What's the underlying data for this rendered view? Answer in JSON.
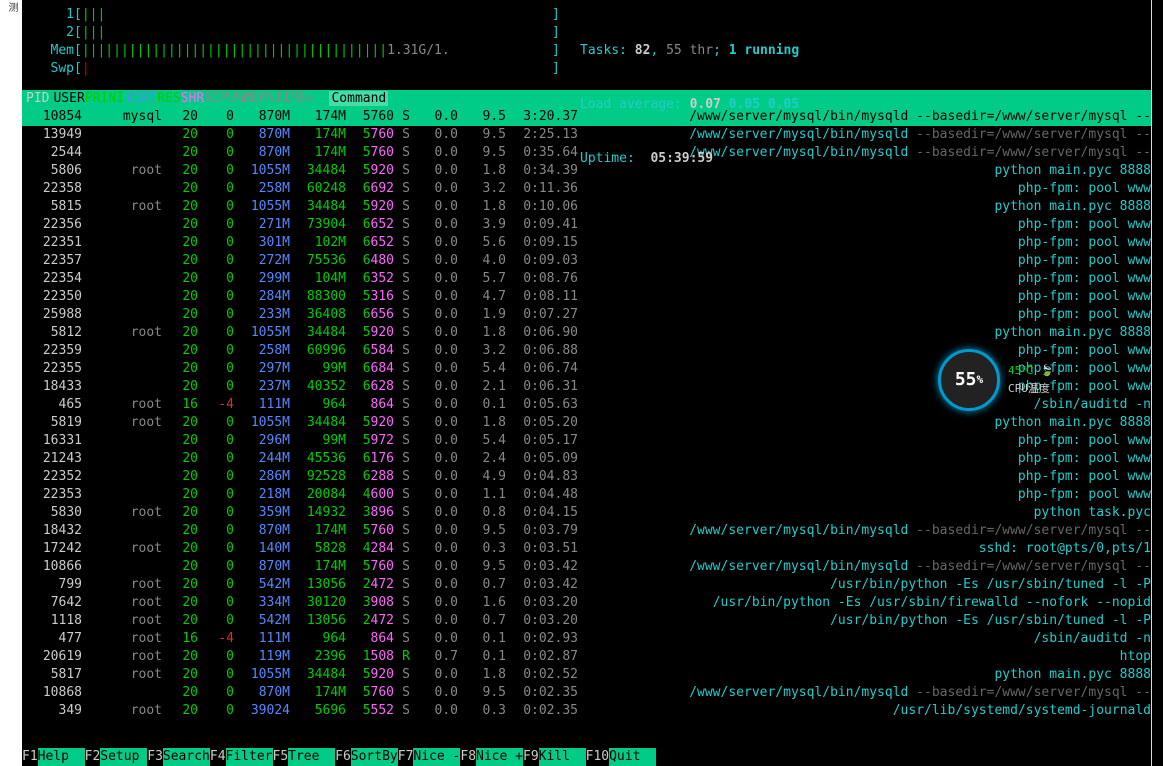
{
  "cpu_meters": [
    {
      "label": "1",
      "bars": "|||",
      "close": "]"
    },
    {
      "label": "2",
      "bars": "|||",
      "close": "]"
    }
  ],
  "mem": {
    "label": "Mem",
    "bars": "|||||||||||||||||||||||||||||||||||||||",
    "text": "1.31G/1.",
    "close": "]"
  },
  "swp": {
    "label": "Swp",
    "bars": "|",
    "close": "]"
  },
  "tasks": {
    "label": "Tasks:",
    "count": "82",
    "sep": ",",
    "thr": "55 thr",
    "running": "1 running"
  },
  "load": {
    "label": "Load average:",
    "v1": "0.07",
    "v2": "0.05",
    "v3": "0.05"
  },
  "uptime": {
    "label": "Uptime:",
    "value": "05:39:59"
  },
  "columns": {
    "pid": "PID",
    "user": "USER",
    "pri": "PRI",
    "ni": "NI",
    "virt": "VIRT",
    "res": "RES",
    "shr": "SHR",
    "s": "S",
    "cpu": "CPU%",
    "mem": "MEM%",
    "time": "TIME+",
    "cmd": "Command"
  },
  "processes": [
    {
      "pid": "10854",
      "user": "mysql",
      "pri": "20",
      "ni": "0",
      "virt": "870M",
      "res": "174M",
      "shr": "5760",
      "s": "S",
      "cpu": "0.0",
      "mem": "9.5",
      "time": "3:20.37",
      "cmd": "/www/server/mysql/bin/mysqld",
      "args": " --basedir=/www/server/mysql --",
      "selected": true
    },
    {
      "pid": "13949",
      "user": "",
      "pri": "20",
      "ni": "0",
      "virt": "870M",
      "res": "174M",
      "shr": "5760",
      "s": "S",
      "cpu": "0.0",
      "mem": "9.5",
      "time": "2:25.13",
      "cmd": "/www/server/mysql/bin/mysqld",
      "args": " --basedir=/www/server/mysql --"
    },
    {
      "pid": "2544",
      "user": "",
      "pri": "20",
      "ni": "0",
      "virt": "870M",
      "res": "174M",
      "shr": "5760",
      "s": "S",
      "cpu": "0.0",
      "mem": "9.5",
      "time": "0:35.64",
      "cmd": "/www/server/mysql/bin/mysqld",
      "args": " --basedir=/www/server/mysql --"
    },
    {
      "pid": "5806",
      "user": "root",
      "pri": "20",
      "ni": "0",
      "virt": "1055M",
      "res": "34484",
      "shr": "5920",
      "s": "S",
      "cpu": "0.0",
      "mem": "1.8",
      "time": "0:34.39",
      "cmd": "python main.pyc 8888",
      "args": ""
    },
    {
      "pid": "22358",
      "user": "",
      "pri": "20",
      "ni": "0",
      "virt": "258M",
      "res": "60248",
      "shr": "6692",
      "s": "S",
      "cpu": "0.0",
      "mem": "3.2",
      "time": "0:11.36",
      "cmd": "php-fpm: pool www",
      "args": ""
    },
    {
      "pid": "5815",
      "user": "root",
      "pri": "20",
      "ni": "0",
      "virt": "1055M",
      "res": "34484",
      "shr": "5920",
      "s": "S",
      "cpu": "0.0",
      "mem": "1.8",
      "time": "0:10.06",
      "cmd": "python main.pyc 8888",
      "args": ""
    },
    {
      "pid": "22356",
      "user": "",
      "pri": "20",
      "ni": "0",
      "virt": "271M",
      "res": "73904",
      "shr": "6652",
      "s": "S",
      "cpu": "0.0",
      "mem": "3.9",
      "time": "0:09.41",
      "cmd": "php-fpm: pool www",
      "args": ""
    },
    {
      "pid": "22351",
      "user": "",
      "pri": "20",
      "ni": "0",
      "virt": "301M",
      "res": "102M",
      "shr": "6652",
      "s": "S",
      "cpu": "0.0",
      "mem": "5.6",
      "time": "0:09.15",
      "cmd": "php-fpm: pool www",
      "args": ""
    },
    {
      "pid": "22357",
      "user": "",
      "pri": "20",
      "ni": "0",
      "virt": "272M",
      "res": "75536",
      "shr": "6480",
      "s": "S",
      "cpu": "0.0",
      "mem": "4.0",
      "time": "0:09.03",
      "cmd": "php-fpm: pool www",
      "args": ""
    },
    {
      "pid": "22354",
      "user": "",
      "pri": "20",
      "ni": "0",
      "virt": "299M",
      "res": "104M",
      "shr": "6352",
      "s": "S",
      "cpu": "0.0",
      "mem": "5.7",
      "time": "0:08.76",
      "cmd": "php-fpm: pool www",
      "args": ""
    },
    {
      "pid": "22350",
      "user": "",
      "pri": "20",
      "ni": "0",
      "virt": "284M",
      "res": "88300",
      "shr": "5316",
      "s": "S",
      "cpu": "0.0",
      "mem": "4.7",
      "time": "0:08.11",
      "cmd": "php-fpm: pool www",
      "args": ""
    },
    {
      "pid": "25988",
      "user": "",
      "pri": "20",
      "ni": "0",
      "virt": "233M",
      "res": "36408",
      "shr": "6656",
      "s": "S",
      "cpu": "0.0",
      "mem": "1.9",
      "time": "0:07.27",
      "cmd": "php-fpm: pool www",
      "args": ""
    },
    {
      "pid": "5812",
      "user": "root",
      "pri": "20",
      "ni": "0",
      "virt": "1055M",
      "res": "34484",
      "shr": "5920",
      "s": "S",
      "cpu": "0.0",
      "mem": "1.8",
      "time": "0:06.90",
      "cmd": "python main.pyc 8888",
      "args": ""
    },
    {
      "pid": "22359",
      "user": "",
      "pri": "20",
      "ni": "0",
      "virt": "258M",
      "res": "60996",
      "shr": "6584",
      "s": "S",
      "cpu": "0.0",
      "mem": "3.2",
      "time": "0:06.88",
      "cmd": "php-fpm: pool www",
      "args": ""
    },
    {
      "pid": "22355",
      "user": "",
      "pri": "20",
      "ni": "0",
      "virt": "297M",
      "res": "99M",
      "shr": "6684",
      "s": "S",
      "cpu": "0.0",
      "mem": "5.4",
      "time": "0:06.74",
      "cmd": "php-fpm: pool www",
      "args": ""
    },
    {
      "pid": "18433",
      "user": "",
      "pri": "20",
      "ni": "0",
      "virt": "237M",
      "res": "40352",
      "shr": "6628",
      "s": "S",
      "cpu": "0.0",
      "mem": "2.1",
      "time": "0:06.31",
      "cmd": "php-fpm: pool www",
      "args": ""
    },
    {
      "pid": "465",
      "user": "root",
      "pri": "16",
      "ni": "-4",
      "virt": "111M",
      "res": "964",
      "shr": "864",
      "s": "S",
      "cpu": "0.0",
      "mem": "0.1",
      "time": "0:05.63",
      "cmd": "/sbin/auditd -n",
      "args": ""
    },
    {
      "pid": "5819",
      "user": "root",
      "pri": "20",
      "ni": "0",
      "virt": "1055M",
      "res": "34484",
      "shr": "5920",
      "s": "S",
      "cpu": "0.0",
      "mem": "1.8",
      "time": "0:05.20",
      "cmd": "python main.pyc 8888",
      "args": ""
    },
    {
      "pid": "16331",
      "user": "",
      "pri": "20",
      "ni": "0",
      "virt": "296M",
      "res": "99M",
      "shr": "5972",
      "s": "S",
      "cpu": "0.0",
      "mem": "5.4",
      "time": "0:05.17",
      "cmd": "php-fpm: pool www",
      "args": ""
    },
    {
      "pid": "21243",
      "user": "",
      "pri": "20",
      "ni": "0",
      "virt": "244M",
      "res": "45536",
      "shr": "6176",
      "s": "S",
      "cpu": "0.0",
      "mem": "2.4",
      "time": "0:05.09",
      "cmd": "php-fpm: pool www",
      "args": ""
    },
    {
      "pid": "22352",
      "user": "",
      "pri": "20",
      "ni": "0",
      "virt": "286M",
      "res": "92528",
      "shr": "6288",
      "s": "S",
      "cpu": "0.0",
      "mem": "4.9",
      "time": "0:04.83",
      "cmd": "php-fpm: pool www",
      "args": ""
    },
    {
      "pid": "22353",
      "user": "",
      "pri": "20",
      "ni": "0",
      "virt": "218M",
      "res": "20084",
      "shr": "4600",
      "s": "S",
      "cpu": "0.0",
      "mem": "1.1",
      "time": "0:04.48",
      "cmd": "php-fpm: pool www",
      "args": ""
    },
    {
      "pid": "5830",
      "user": "root",
      "pri": "20",
      "ni": "0",
      "virt": "359M",
      "res": "14932",
      "shr": "3896",
      "s": "S",
      "cpu": "0.0",
      "mem": "0.8",
      "time": "0:04.15",
      "cmd": "python task.pyc",
      "args": ""
    },
    {
      "pid": "18432",
      "user": "",
      "pri": "20",
      "ni": "0",
      "virt": "870M",
      "res": "174M",
      "shr": "5760",
      "s": "S",
      "cpu": "0.0",
      "mem": "9.5",
      "time": "0:03.79",
      "cmd": "/www/server/mysql/bin/mysqld",
      "args": " --basedir=/www/server/mysql --"
    },
    {
      "pid": "17242",
      "user": "root",
      "pri": "20",
      "ni": "0",
      "virt": "140M",
      "res": "5828",
      "shr": "4284",
      "s": "S",
      "cpu": "0.0",
      "mem": "0.3",
      "time": "0:03.51",
      "cmd": "sshd: root@pts/0,pts/1",
      "args": ""
    },
    {
      "pid": "10866",
      "user": "",
      "pri": "20",
      "ni": "0",
      "virt": "870M",
      "res": "174M",
      "shr": "5760",
      "s": "S",
      "cpu": "0.0",
      "mem": "9.5",
      "time": "0:03.42",
      "cmd": "/www/server/mysql/bin/mysqld",
      "args": " --basedir=/www/server/mysql --"
    },
    {
      "pid": "799",
      "user": "root",
      "pri": "20",
      "ni": "0",
      "virt": "542M",
      "res": "13056",
      "shr": "2472",
      "s": "S",
      "cpu": "0.0",
      "mem": "0.7",
      "time": "0:03.42",
      "cmd": "/usr/bin/python -Es /usr/sbin/tuned -l -P",
      "args": ""
    },
    {
      "pid": "7642",
      "user": "root",
      "pri": "20",
      "ni": "0",
      "virt": "334M",
      "res": "30120",
      "shr": "3908",
      "s": "S",
      "cpu": "0.0",
      "mem": "1.6",
      "time": "0:03.20",
      "cmd": "/usr/bin/python -Es /usr/sbin/firewalld --nofork --nopid",
      "args": ""
    },
    {
      "pid": "1118",
      "user": "root",
      "pri": "20",
      "ni": "0",
      "virt": "542M",
      "res": "13056",
      "shr": "2472",
      "s": "S",
      "cpu": "0.0",
      "mem": "0.7",
      "time": "0:03.20",
      "cmd": "/usr/bin/python -Es /usr/sbin/tuned -l -P",
      "args": ""
    },
    {
      "pid": "477",
      "user": "root",
      "pri": "16",
      "ni": "-4",
      "virt": "111M",
      "res": "964",
      "shr": "864",
      "s": "S",
      "cpu": "0.0",
      "mem": "0.1",
      "time": "0:02.93",
      "cmd": "/sbin/auditd -n",
      "args": ""
    },
    {
      "pid": "20619",
      "user": "root",
      "pri": "20",
      "ni": "0",
      "virt": "119M",
      "res": "2396",
      "shr": "1508",
      "s": "R",
      "cpu": "0.7",
      "mem": "0.1",
      "time": "0:02.87",
      "cmd": "htop",
      "args": ""
    },
    {
      "pid": "5817",
      "user": "root",
      "pri": "20",
      "ni": "0",
      "virt": "1055M",
      "res": "34484",
      "shr": "5920",
      "s": "S",
      "cpu": "0.0",
      "mem": "1.8",
      "time": "0:02.52",
      "cmd": "python main.pyc 8888",
      "args": ""
    },
    {
      "pid": "10868",
      "user": "",
      "pri": "20",
      "ni": "0",
      "virt": "870M",
      "res": "174M",
      "shr": "5760",
      "s": "S",
      "cpu": "0.0",
      "mem": "9.5",
      "time": "0:02.35",
      "cmd": "/www/server/mysql/bin/mysqld",
      "args": " --basedir=/www/server/mysql --"
    },
    {
      "pid": "349",
      "user": "root",
      "pri": "20",
      "ni": "0",
      "virt": "39024",
      "res": "5696",
      "shr": "5552",
      "s": "S",
      "cpu": "0.0",
      "mem": "0.3",
      "time": "0:02.35",
      "cmd": "/usr/lib/systemd/systemd-journald",
      "args": ""
    }
  ],
  "footer": [
    {
      "key": "F1",
      "label": "Help  "
    },
    {
      "key": "F2",
      "label": "Setup "
    },
    {
      "key": "F3",
      "label": "Search"
    },
    {
      "key": "F4",
      "label": "Filter"
    },
    {
      "key": "F5",
      "label": "Tree  "
    },
    {
      "key": "F6",
      "label": "SortBy"
    },
    {
      "key": "F7",
      "label": "Nice -"
    },
    {
      "key": "F8",
      "label": "Nice +"
    },
    {
      "key": "F9",
      "label": "Kill  "
    },
    {
      "key": "F10",
      "label": "Quit  "
    }
  ],
  "widget": {
    "percent": "55",
    "pct_label": "%",
    "temp": "45℃",
    "label": "CPU温度"
  },
  "left_tab": "测"
}
